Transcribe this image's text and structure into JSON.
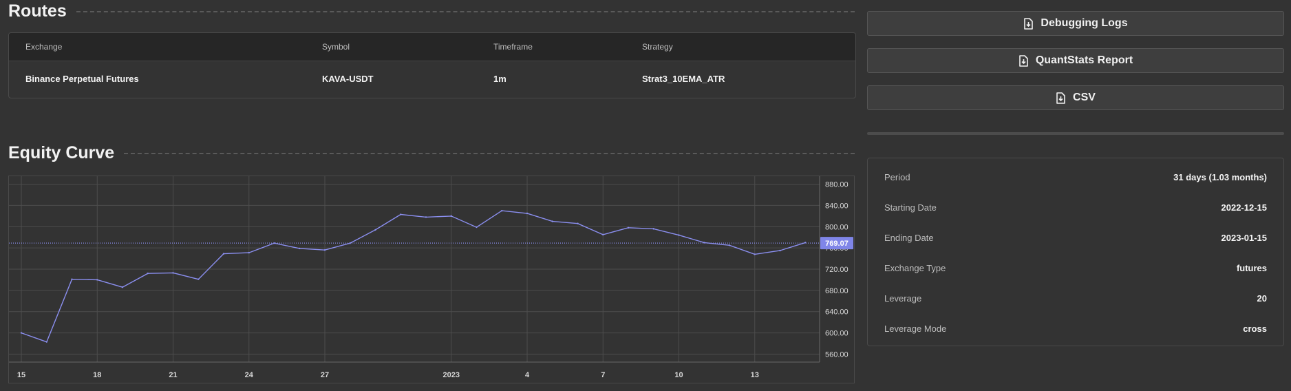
{
  "routes": {
    "title": "Routes",
    "headers": [
      "Exchange",
      "Symbol",
      "Timeframe",
      "Strategy"
    ],
    "row": [
      "Binance Perpetual Futures",
      "KAVA-USDT",
      "1m",
      "Strat3_10EMA_ATR"
    ]
  },
  "actions": {
    "debug_label": "Debugging Logs",
    "quantstats_label": "QuantStats Report",
    "csv_label": "CSV"
  },
  "equity": {
    "title": "Equity Curve"
  },
  "info": {
    "rows": [
      {
        "label": "Period",
        "value": "31 days (1.03 months)"
      },
      {
        "label": "Starting Date",
        "value": "2022-12-15"
      },
      {
        "label": "Ending Date",
        "value": "2023-01-15"
      },
      {
        "label": "Exchange Type",
        "value": "futures"
      },
      {
        "label": "Leverage",
        "value": "20"
      },
      {
        "label": "Leverage Mode",
        "value": "cross"
      }
    ]
  },
  "colors": {
    "line": "#8b8ff0",
    "price_label_bg": "#7f85e8",
    "background": "#333333"
  },
  "chart_data": {
    "type": "line",
    "x_tick_labels": [
      "15",
      "18",
      "21",
      "24",
      "27",
      "2023",
      "4",
      "7",
      "10",
      "13"
    ],
    "y_tick_labels": [
      "560.00",
      "600.00",
      "640.00",
      "680.00",
      "720.00",
      "760.00",
      "800.00",
      "840.00",
      "880.00"
    ],
    "ylim": [
      545,
      895
    ],
    "current_value": 769.07,
    "current_value_label": "769.07",
    "grid": true,
    "series": [
      {
        "values": [
          600,
          583,
          701,
          700,
          686,
          712,
          713,
          701,
          749,
          751,
          769,
          759,
          756,
          769,
          794,
          823,
          818,
          820,
          799,
          830,
          825,
          810,
          806,
          785,
          798,
          796,
          784,
          770,
          765,
          748,
          755,
          770
        ]
      }
    ]
  }
}
